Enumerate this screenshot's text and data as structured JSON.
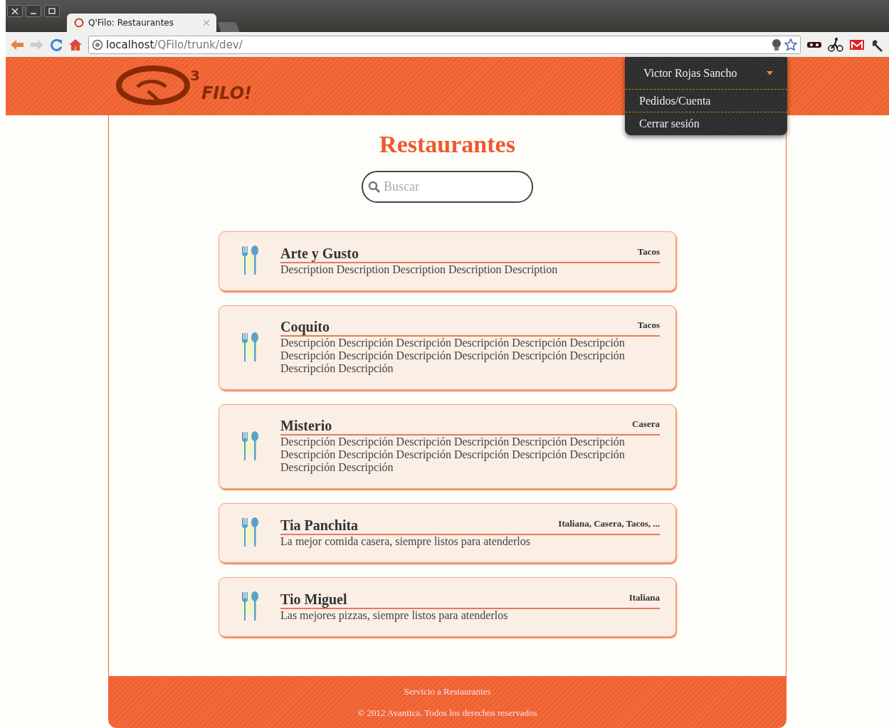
{
  "browser": {
    "tab_title": "Q'Filo: Restaurantes",
    "url_host": "localhost",
    "url_path": "/QFilo/trunk/dev/"
  },
  "header": {
    "logo_superscript": "3",
    "logo_text": "FILO!"
  },
  "user_menu": {
    "user": "Victor Rojas Sancho",
    "expanded": true,
    "items": [
      "Pedidos/Cuenta",
      "Cerrar sesión"
    ]
  },
  "page_title": "Restaurantes",
  "search": {
    "placeholder": "Buscar"
  },
  "restaurants": [
    {
      "name": "Arte y Gusto",
      "tags": "Tacos",
      "description": "Description Description Description Description Description"
    },
    {
      "name": "Coquito",
      "tags": "Tacos",
      "description": "Descripción Descripción Descripción Descripción Descripción Descripción Descripción Descripción Descripción Descripción Descripción Descripción Descripción Descripción"
    },
    {
      "name": "Misterio",
      "tags": "Casera",
      "description": "Descripción Descripción Descripción Descripción Descripción Descripción Descripción Descripción Descripción Descripción Descripción Descripción Descripción Descripción"
    },
    {
      "name": "Tia Panchita",
      "tags": "Italiana, Casera, Tacos, ...",
      "description": "La mejor comida casera, siempre listos para atenderlos"
    },
    {
      "name": "Tio Miguel",
      "tags": "Italiana",
      "description": "Las mejores pizzas, siempre listos para atenderlos"
    }
  ],
  "footer": {
    "line_1": "Servicio a Restaurantes",
    "line_2": "© 2012 Avantica. Todos los derechos reservados"
  }
}
